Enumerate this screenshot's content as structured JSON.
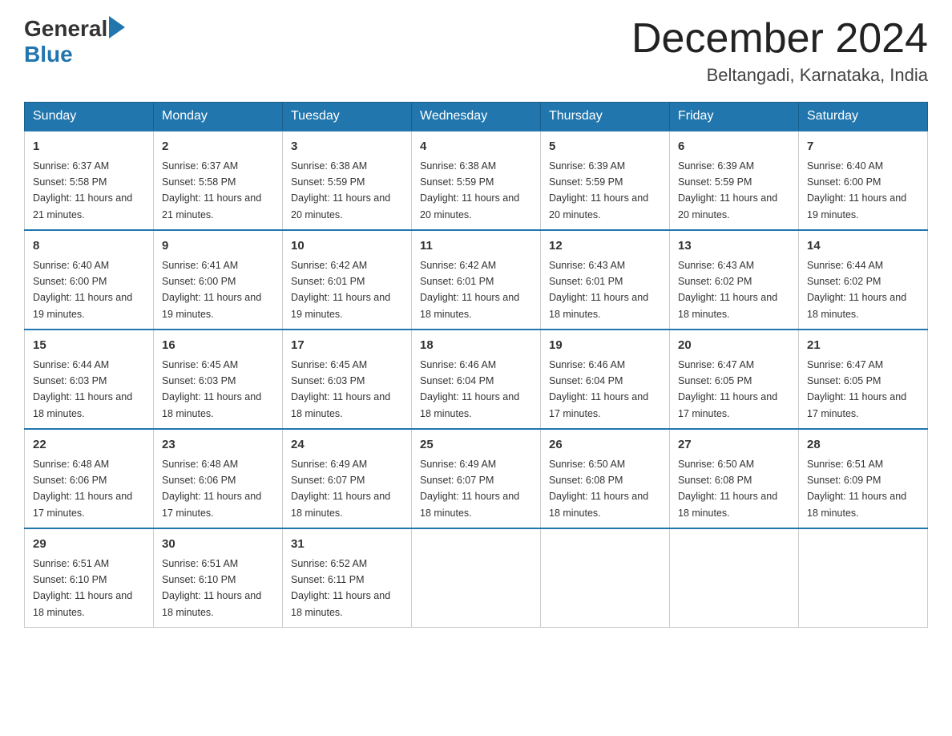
{
  "header": {
    "logo_general": "General",
    "logo_blue": "Blue",
    "month_title": "December 2024",
    "location": "Beltangadi, Karnataka, India"
  },
  "days_of_week": [
    "Sunday",
    "Monday",
    "Tuesday",
    "Wednesday",
    "Thursday",
    "Friday",
    "Saturday"
  ],
  "weeks": [
    [
      {
        "day": "1",
        "sunrise": "6:37 AM",
        "sunset": "5:58 PM",
        "daylight": "11 hours and 21 minutes."
      },
      {
        "day": "2",
        "sunrise": "6:37 AM",
        "sunset": "5:58 PM",
        "daylight": "11 hours and 21 minutes."
      },
      {
        "day": "3",
        "sunrise": "6:38 AM",
        "sunset": "5:59 PM",
        "daylight": "11 hours and 20 minutes."
      },
      {
        "day": "4",
        "sunrise": "6:38 AM",
        "sunset": "5:59 PM",
        "daylight": "11 hours and 20 minutes."
      },
      {
        "day": "5",
        "sunrise": "6:39 AM",
        "sunset": "5:59 PM",
        "daylight": "11 hours and 20 minutes."
      },
      {
        "day": "6",
        "sunrise": "6:39 AM",
        "sunset": "5:59 PM",
        "daylight": "11 hours and 20 minutes."
      },
      {
        "day": "7",
        "sunrise": "6:40 AM",
        "sunset": "6:00 PM",
        "daylight": "11 hours and 19 minutes."
      }
    ],
    [
      {
        "day": "8",
        "sunrise": "6:40 AM",
        "sunset": "6:00 PM",
        "daylight": "11 hours and 19 minutes."
      },
      {
        "day": "9",
        "sunrise": "6:41 AM",
        "sunset": "6:00 PM",
        "daylight": "11 hours and 19 minutes."
      },
      {
        "day": "10",
        "sunrise": "6:42 AM",
        "sunset": "6:01 PM",
        "daylight": "11 hours and 19 minutes."
      },
      {
        "day": "11",
        "sunrise": "6:42 AM",
        "sunset": "6:01 PM",
        "daylight": "11 hours and 18 minutes."
      },
      {
        "day": "12",
        "sunrise": "6:43 AM",
        "sunset": "6:01 PM",
        "daylight": "11 hours and 18 minutes."
      },
      {
        "day": "13",
        "sunrise": "6:43 AM",
        "sunset": "6:02 PM",
        "daylight": "11 hours and 18 minutes."
      },
      {
        "day": "14",
        "sunrise": "6:44 AM",
        "sunset": "6:02 PM",
        "daylight": "11 hours and 18 minutes."
      }
    ],
    [
      {
        "day": "15",
        "sunrise": "6:44 AM",
        "sunset": "6:03 PM",
        "daylight": "11 hours and 18 minutes."
      },
      {
        "day": "16",
        "sunrise": "6:45 AM",
        "sunset": "6:03 PM",
        "daylight": "11 hours and 18 minutes."
      },
      {
        "day": "17",
        "sunrise": "6:45 AM",
        "sunset": "6:03 PM",
        "daylight": "11 hours and 18 minutes."
      },
      {
        "day": "18",
        "sunrise": "6:46 AM",
        "sunset": "6:04 PM",
        "daylight": "11 hours and 18 minutes."
      },
      {
        "day": "19",
        "sunrise": "6:46 AM",
        "sunset": "6:04 PM",
        "daylight": "11 hours and 17 minutes."
      },
      {
        "day": "20",
        "sunrise": "6:47 AM",
        "sunset": "6:05 PM",
        "daylight": "11 hours and 17 minutes."
      },
      {
        "day": "21",
        "sunrise": "6:47 AM",
        "sunset": "6:05 PM",
        "daylight": "11 hours and 17 minutes."
      }
    ],
    [
      {
        "day": "22",
        "sunrise": "6:48 AM",
        "sunset": "6:06 PM",
        "daylight": "11 hours and 17 minutes."
      },
      {
        "day": "23",
        "sunrise": "6:48 AM",
        "sunset": "6:06 PM",
        "daylight": "11 hours and 17 minutes."
      },
      {
        "day": "24",
        "sunrise": "6:49 AM",
        "sunset": "6:07 PM",
        "daylight": "11 hours and 18 minutes."
      },
      {
        "day": "25",
        "sunrise": "6:49 AM",
        "sunset": "6:07 PM",
        "daylight": "11 hours and 18 minutes."
      },
      {
        "day": "26",
        "sunrise": "6:50 AM",
        "sunset": "6:08 PM",
        "daylight": "11 hours and 18 minutes."
      },
      {
        "day": "27",
        "sunrise": "6:50 AM",
        "sunset": "6:08 PM",
        "daylight": "11 hours and 18 minutes."
      },
      {
        "day": "28",
        "sunrise": "6:51 AM",
        "sunset": "6:09 PM",
        "daylight": "11 hours and 18 minutes."
      }
    ],
    [
      {
        "day": "29",
        "sunrise": "6:51 AM",
        "sunset": "6:10 PM",
        "daylight": "11 hours and 18 minutes."
      },
      {
        "day": "30",
        "sunrise": "6:51 AM",
        "sunset": "6:10 PM",
        "daylight": "11 hours and 18 minutes."
      },
      {
        "day": "31",
        "sunrise": "6:52 AM",
        "sunset": "6:11 PM",
        "daylight": "11 hours and 18 minutes."
      },
      null,
      null,
      null,
      null
    ]
  ],
  "labels": {
    "sunrise": "Sunrise:",
    "sunset": "Sunset:",
    "daylight": "Daylight:"
  }
}
